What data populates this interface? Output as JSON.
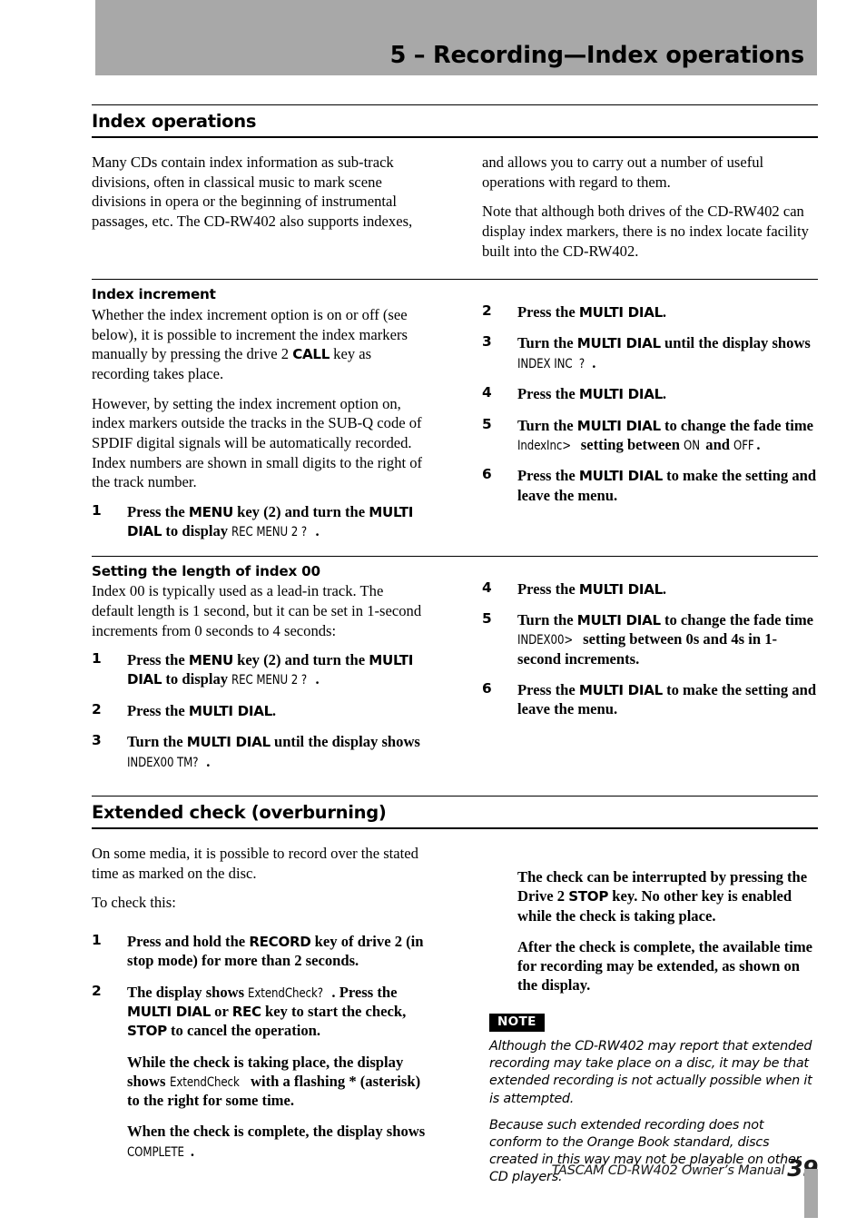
{
  "header": {
    "title": "5 – Recording—Index operations"
  },
  "sections": [
    {
      "id": "index-operations",
      "heading": "Index operations",
      "left_paragraphs": [
        "Many CDs contain index information as sub-track divisions, often in classical music to mark scene divisions in opera or the beginning of instrumental passages, etc. The CD-RW402 also supports indexes,"
      ],
      "right_paragraphs": [
        "and allows you to carry out a number of useful operations with regard to them.",
        "Note that although both drives of the CD-RW402 can display index markers, there is no index locate facility built into the CD-RW402."
      ]
    },
    {
      "id": "index-increment",
      "heading": "Index increment",
      "left_paragraphs": [
        "Whether the index increment option is on or off (see below), it is possible to increment the index markers manually by pressing the drive 2 CALL key as recording takes place.",
        "However, by setting the index increment option on, index markers outside the tracks in the SUB-Q code of SPDIF digital signals will be automatically recorded. Index numbers are shown in small digits to the right of the track number."
      ],
      "left_steps": [
        {
          "num": "1",
          "text": "Press the MENU key (2) and turn the MULTI DIAL to display REC MENU 2 ?."
        }
      ],
      "right_steps": [
        {
          "num": "2",
          "text": "Press the MULTI DIAL."
        },
        {
          "num": "3",
          "text": "Turn the MULTI DIAL until the display shows INDEX INC ?."
        },
        {
          "num": "4",
          "text": "Press the MULTI DIAL."
        },
        {
          "num": "5",
          "text": "Turn the MULTI DIAL to change the fade time IndexInc> setting between ON and OFF."
        },
        {
          "num": "6",
          "text": "Press the MULTI DIAL to make the setting and leave the menu."
        }
      ]
    },
    {
      "id": "index-00-length",
      "heading": "Setting the length of index 00",
      "left_paragraphs": [
        "Index 00 is typically used as a lead-in track. The default length is 1 second, but it can be set in 1-second increments from 0 seconds to 4 seconds:"
      ],
      "left_steps": [
        {
          "num": "1",
          "text": "Press the MENU key (2) and turn the MULTI DIAL to display REC MENU 2 ?."
        },
        {
          "num": "2",
          "text": "Press the MULTI DIAL."
        },
        {
          "num": "3",
          "text": "Turn the MULTI DIAL until the display shows INDEX00 TM?."
        }
      ],
      "right_steps": [
        {
          "num": "4",
          "text": "Press the MULTI DIAL."
        },
        {
          "num": "5",
          "text": "Turn the MULTI DIAL to change the fade time INDEX00> setting between 0s and 4s in 1-second increments."
        },
        {
          "num": "6",
          "text": "Press the MULTI DIAL to make the setting and leave the menu."
        }
      ]
    },
    {
      "id": "extended-check",
      "heading": "Extended check (overburning)",
      "left_paragraphs": [
        "On some media, it is possible to record over the stated time as marked on the disc.",
        "To check this:"
      ],
      "left_steps": [
        {
          "num": "1",
          "text": "Press and hold the RECORD key of drive 2 (in stop mode) for more than 2 seconds."
        },
        {
          "num": "2",
          "text": "The display shows ExtendCheck?. Press the MULTI DIAL or REC key to start the check, STOP to cancel the operation."
        }
      ],
      "left_continuations": [
        "While the check is taking place, the display shows ExtendCheck with a flashing * (asterisk) to the right for some time.",
        "When the check is complete, the display shows COMPLETE."
      ],
      "right_continuations": [
        "The check can be interrupted by pressing the Drive 2 STOP key. No other key is enabled while the check is taking place.",
        "After the check is complete, the available time for recording may be extended, as shown on the display."
      ],
      "note": {
        "badge": "NOTE",
        "paragraphs": [
          "Although the CD-RW402 may report that extended recording may take place on a disc, it may be that extended recording is not actually possible when it is attempted.",
          "Because such extended recording does not conform to the Orange Book standard, discs created in this way may not be playable on other CD players."
        ]
      }
    }
  ],
  "footer": {
    "text": "TASCAM CD-RW402 Owner’s Manual",
    "page_number": "39"
  },
  "colors": {
    "header_bar": "#a8a8a8",
    "text": "#000000",
    "note_badge_bg": "#000000"
  }
}
